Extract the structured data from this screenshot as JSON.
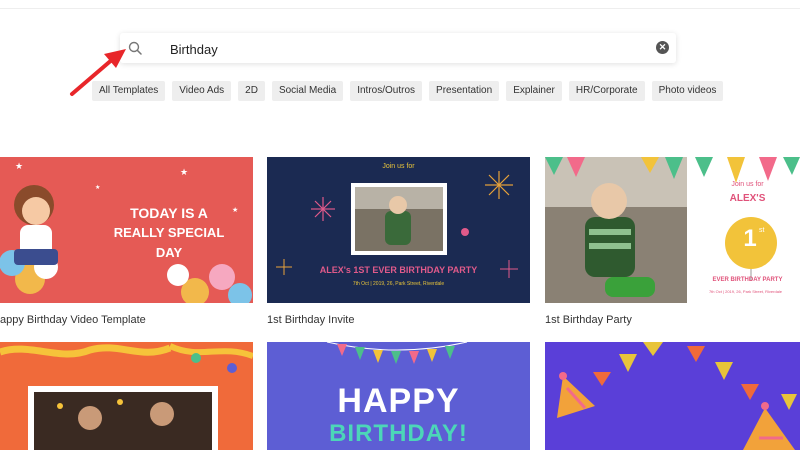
{
  "search": {
    "query": "Birthday",
    "search_icon": "search-icon",
    "clear_icon": "close-circle-icon"
  },
  "annotation": {
    "arrow_color": "#e8262a",
    "arrow_icon": "arrow-pointer-icon"
  },
  "categories": [
    "All Templates",
    "Video Ads",
    "2D",
    "Social Media",
    "Intros/Outros",
    "Presentation",
    "Explainer",
    "HR/Corporate",
    "Photo videos"
  ],
  "templates": [
    {
      "title": "appy Birthday Video Template",
      "thumb_text_line1": "TODAY IS A",
      "thumb_text_line2": "REALLY SPECIAL DAY",
      "color": "#e55a55"
    },
    {
      "title": "1st Birthday Invite",
      "thumb_top": "Join us for",
      "thumb_headline": "ALEX's 1ST EVER BIRTHDAY PARTY",
      "thumb_details": "7th Oct | 2019, 26, Park Street, Riverdale",
      "color": "#1b2a52"
    },
    {
      "title": "1st Birthday Party",
      "thumb_top": "Join us for",
      "thumb_name": "ALEX'S",
      "thumb_number": "1",
      "thumb_suffix": "st",
      "thumb_headline": "EVER BIRTHDAY PARTY",
      "thumb_details": "7th Oct | 2019, 26, Park Street, Riverdale",
      "color": "#ffffff"
    },
    {
      "title": "",
      "color": "#f06a3a"
    },
    {
      "title": "",
      "thumb_line1": "HAPPY",
      "thumb_line2": "BIRTHDAY!",
      "color": "#5d5ed4"
    },
    {
      "title": "",
      "color": "#5a3fd8"
    }
  ]
}
